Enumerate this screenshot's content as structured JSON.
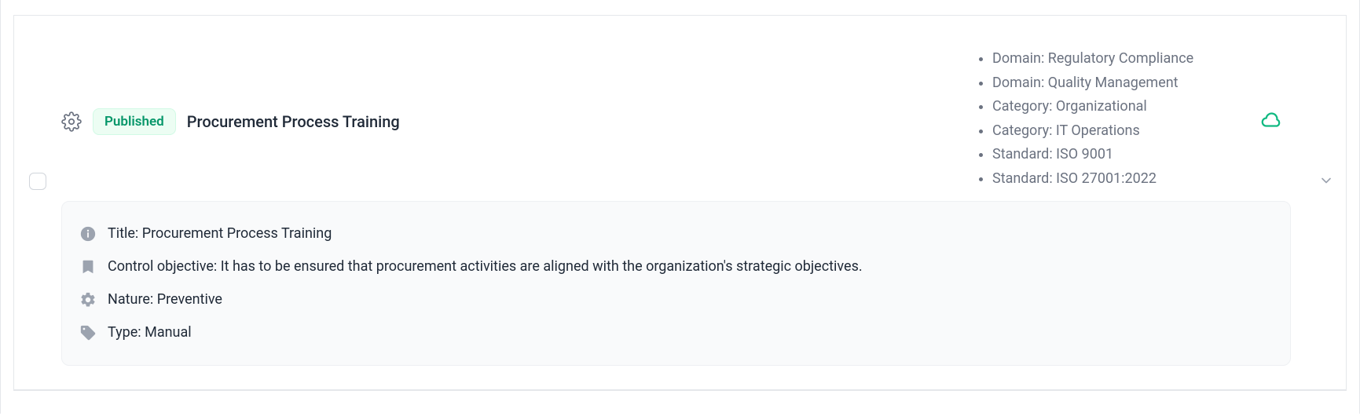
{
  "item": {
    "status": "Published",
    "title": "Procurement Process Training",
    "meta": [
      "Domain: Regulatory Compliance",
      "Domain: Quality Management",
      "Category: Organizational",
      "Category: IT Operations",
      "Standard: ISO 9001",
      "Standard: ISO 27001:2022"
    ],
    "details": {
      "title_line": "Title: Procurement Process Training",
      "objective_line": "Control objective: It has to be ensured that procurement activities are aligned with the organization's strategic objectives.",
      "nature_line": "Nature: Preventive",
      "type_line": "Type: Manual"
    }
  }
}
